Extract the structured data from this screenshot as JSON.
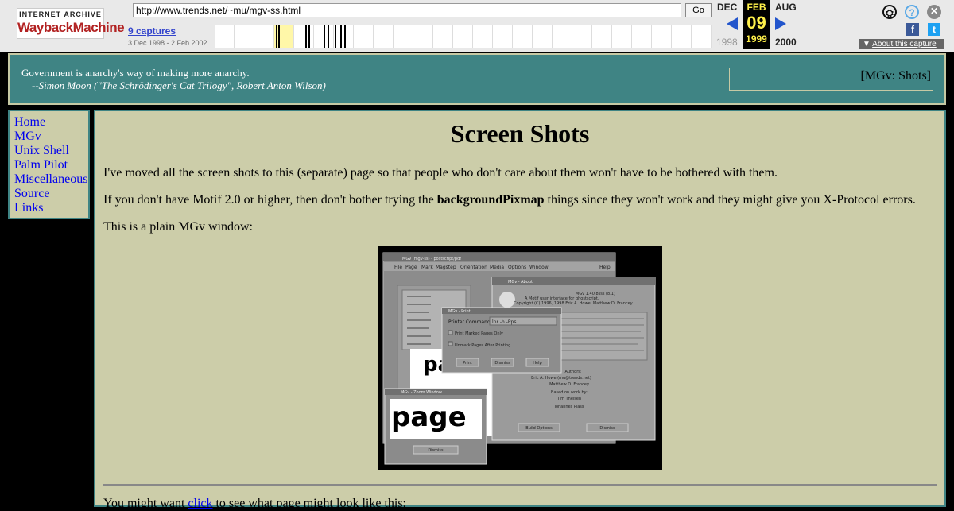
{
  "wayback": {
    "logo_top": "INTERNET ARCHIVE",
    "logo_main": "WaybackMachine",
    "url": "http://www.trends.net/~mu/mgv-ss.html",
    "go_label": "Go",
    "captures": "9 captures",
    "range": "3 Dec 1998 - 2 Feb 2002",
    "prev_month": "DEC",
    "cur_month": "FEB",
    "next_month": "AUG",
    "prev_year": "1998",
    "cur_day": "09",
    "cur_year": "1999",
    "next_year": "2000",
    "about": "About this capture",
    "about_icon": "caret-down-icon"
  },
  "quote": {
    "text": "Government is anarchy's way of making more anarchy.",
    "attribution": "--Simon Moon (\"The Schrödinger's Cat Trilogy\", Robert Anton Wilson)",
    "image_alt": "[MGv: Shots]"
  },
  "nav": {
    "items": [
      "Home",
      "MGv",
      "Unix Shell",
      "Palm Pilot",
      "Miscellaneous",
      "Source",
      "Links"
    ]
  },
  "main": {
    "title": "Screen Shots",
    "p1": "I've moved all the screen shots to this (separate) page so that people who don't care about them won't have to be bothered with them.",
    "p2_before": "If you don't have Motif 2.0 or higher, then don't bother trying the ",
    "p2_bold": "backgroundPixmap",
    "p2_after": " things since they won't work and they might give you X-Protocol errors.",
    "p3": "This is a plain MGv window:",
    "bottom_before": "You might want ",
    "bottom_link": "click",
    "bottom_after": " to see what page might look like this:"
  },
  "screenshot": {
    "main_title": "MGv (mgv-ss) - postscript/pdf",
    "menus": [
      "File",
      "Page",
      "Mark",
      "Magstep",
      "Orientation",
      "Media",
      "Options",
      "Window",
      "Help"
    ],
    "about_title": "MGv - About",
    "about_lines": [
      "MGv 1.40.8sss (8.1)",
      "A Motif user interface for ghostscript.",
      "Copyright (C) 1996, 1998 Eric A. Howe, Matthew D. Francey"
    ],
    "print_title": "MGv - Print",
    "print_label": "Printer Command:",
    "print_value": "lpr -h -Pps",
    "print_opt1": "Print Marked Pages Only",
    "print_opt2": "Unmark Pages After Printing",
    "print_buttons": [
      "Print",
      "Dismiss",
      "Help"
    ],
    "zoom_title": "MGv - Zoom Window",
    "zoom_text": "page",
    "zoom_button": "Dismiss",
    "credit_lines": [
      "Authors:",
      "Eric A. Howe (mu@trends.net)",
      "Matthew D. Francey",
      "Based on work by:",
      "Tim Theisen",
      "Johannes Plass"
    ],
    "about_buttons": [
      "Build Options",
      "Dismiss"
    ]
  }
}
